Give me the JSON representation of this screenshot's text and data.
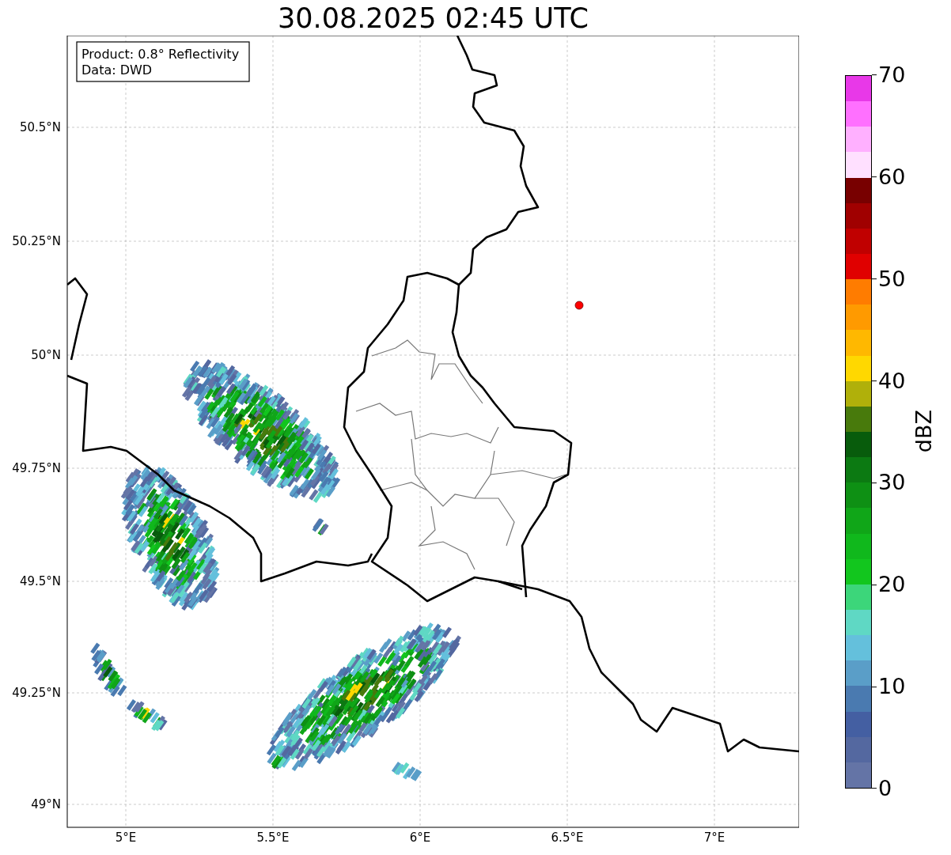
{
  "title": "30.08.2025 02:45 UTC",
  "info_box": {
    "lines": [
      "Product: 0.8° Reflectivity",
      "Data: DWD"
    ]
  },
  "map": {
    "x_ticks": [
      "5°E",
      "5.5°E",
      "6°E",
      "6.5°E",
      "7°E"
    ],
    "y_ticks": [
      "50.5°N",
      "50.25°N",
      "50°N",
      "49.75°N",
      "49.5°N",
      "49.25°N",
      "49°N"
    ]
  },
  "colorbar": {
    "label": "dBZ",
    "ticks": [
      "70",
      "60",
      "50",
      "40",
      "30",
      "20",
      "10",
      "0"
    ],
    "bins": [
      {
        "color": "#e838e8"
      },
      {
        "color": "#ff70ff"
      },
      {
        "color": "#ffb0ff"
      },
      {
        "color": "#ffe0ff"
      },
      {
        "color": "#780000"
      },
      {
        "color": "#a00000"
      },
      {
        "color": "#c00000"
      },
      {
        "color": "#e00000"
      },
      {
        "color": "#ff7c00"
      },
      {
        "color": "#ff9a00"
      },
      {
        "color": "#ffb800"
      },
      {
        "color": "#ffd800"
      },
      {
        "color": "#b0b00a"
      },
      {
        "color": "#487a0c"
      },
      {
        "color": "#085c0c"
      },
      {
        "color": "#0c7a12"
      },
      {
        "color": "#0e9014"
      },
      {
        "color": "#10a618"
      },
      {
        "color": "#10b81c"
      },
      {
        "color": "#12c61e"
      },
      {
        "color": "#3cd67a"
      },
      {
        "color": "#5fd8c4"
      },
      {
        "color": "#64c0dc"
      },
      {
        "color": "#5a9ec8"
      },
      {
        "color": "#4a7ab0"
      },
      {
        "color": "#445fa2"
      },
      {
        "color": "#5468a0"
      },
      {
        "color": "#6474a6"
      }
    ]
  }
}
